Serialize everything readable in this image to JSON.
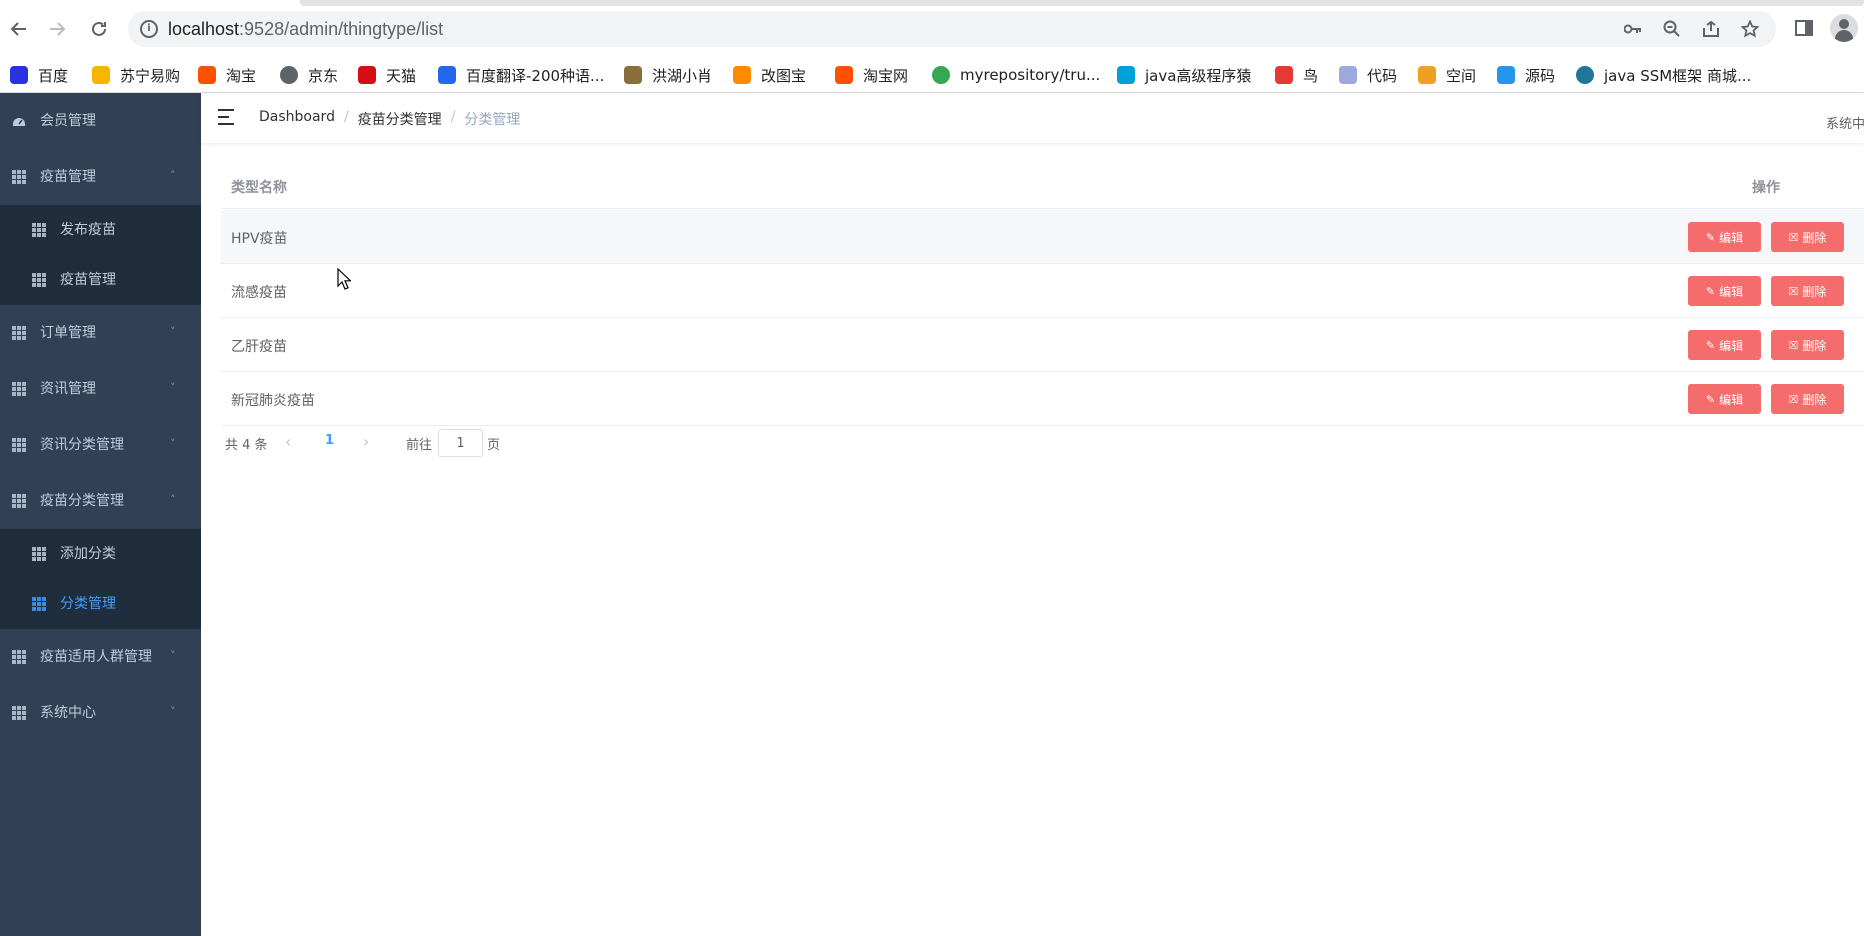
{
  "browser": {
    "url_host": "localhost",
    "url_rest": ":9528/admin/thingtype/list",
    "bookmarks": [
      {
        "label": "百度",
        "icon": "baidu-paw-icon",
        "color": "#2932e1"
      },
      {
        "label": "苏宁易购",
        "icon": "suning-lion-icon",
        "color": "#f7b500"
      },
      {
        "label": "淘宝",
        "icon": "taobao-icon",
        "color": "#ff5000"
      },
      {
        "label": "京东",
        "icon": "globe-icon",
        "color": "#5f6368"
      },
      {
        "label": "天猫",
        "icon": "tmall-icon",
        "color": "#d40e14"
      },
      {
        "label": "百度翻译-200种语...",
        "icon": "translate-icon",
        "color": "#2468f2"
      },
      {
        "label": "洪湖小肖",
        "icon": "bird-icon",
        "color": "#8a6d3b"
      },
      {
        "label": "改图宝",
        "icon": "gaitubao-icon",
        "color": "#ff8a00"
      },
      {
        "label": "淘宝网",
        "icon": "taobao-icon",
        "color": "#ff5000"
      },
      {
        "label": "myrepository/tru...",
        "icon": "chrome-icon",
        "color": "#34a853"
      },
      {
        "label": "java高级程序猿",
        "icon": "bilibili-icon",
        "color": "#00a1d6"
      },
      {
        "label": "鸟",
        "icon": "bird-red-icon",
        "color": "#e53935"
      },
      {
        "label": "代码",
        "icon": "code-icon",
        "color": "#9fa8da"
      },
      {
        "label": "空间",
        "icon": "space-icon",
        "color": "#f0a020"
      },
      {
        "label": "源码",
        "icon": "docker-whale-icon",
        "color": "#2496ed"
      },
      {
        "label": "java SSM框架 商城...",
        "icon": "wordpress-icon",
        "color": "#21759b"
      }
    ]
  },
  "sidebar": {
    "items": [
      {
        "label": "会员管理",
        "expanded": null
      },
      {
        "label": "疫苗管理",
        "expanded": true,
        "children": [
          "发布疫苗",
          "疫苗管理"
        ]
      },
      {
        "label": "订单管理",
        "expanded": false
      },
      {
        "label": "资讯管理",
        "expanded": false
      },
      {
        "label": "资讯分类管理",
        "expanded": false
      },
      {
        "label": "疫苗分类管理",
        "expanded": true,
        "children": [
          "添加分类",
          "分类管理"
        ],
        "active_child": "分类管理"
      },
      {
        "label": "疫苗适用人群管理",
        "expanded": false
      },
      {
        "label": "系统中心",
        "expanded": false
      }
    ]
  },
  "navbar": {
    "breadcrumb": [
      "Dashboard",
      "疫苗分类管理",
      "分类管理"
    ],
    "right_text": "系统中"
  },
  "table": {
    "headers": [
      "类型名称",
      "操作"
    ],
    "rows": [
      "HPV疫苗",
      "流感疫苗",
      "乙肝疫苗",
      "新冠肺炎疫苗"
    ],
    "edit_label": "编辑",
    "delete_label": "删除"
  },
  "pagination": {
    "total": "共 4 条",
    "current_page": "1",
    "goto_prefix": "前往",
    "goto_value": "1",
    "goto_suffix": "页"
  },
  "colors": {
    "sidebar_bg": "#304156",
    "submenu_bg": "#1f2d3d",
    "active": "#409eff",
    "danger": "#f56c6c"
  }
}
